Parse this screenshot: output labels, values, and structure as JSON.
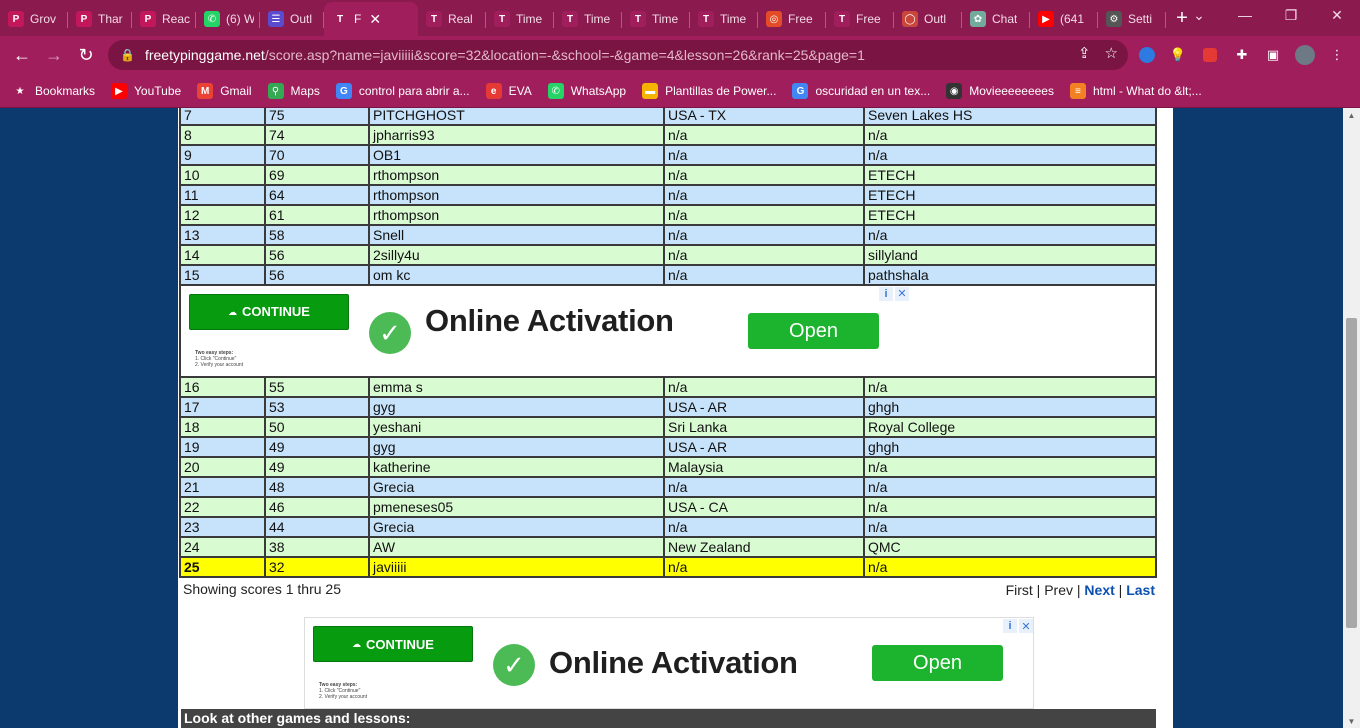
{
  "colors": {
    "tab_bg": "#8b1a4f",
    "toolbar_bg": "#a01e5c",
    "page_bg": "#0d3a6e",
    "row_blue": "#c7e3fb",
    "row_green": "#d9fbd2",
    "highlight": "#ffff00",
    "ad_green": "#079c10",
    "link": "#0b4fb0"
  },
  "tabs": [
    {
      "label": "Grov",
      "icon": "p-logo-icon",
      "color": "#c2185b"
    },
    {
      "label": "Thar",
      "icon": "p-logo-icon",
      "color": "#c2185b"
    },
    {
      "label": "Reac",
      "icon": "p-logo-icon",
      "color": "#c2185b"
    },
    {
      "label": "(6) W",
      "icon": "whatsapp-icon",
      "color": "#25d366"
    },
    {
      "label": "Outl",
      "icon": "list-icon",
      "color": "#5b4ccf"
    },
    {
      "label": "F",
      "icon": "t-logo-icon",
      "color": "#a01e5c",
      "active": true
    },
    {
      "label": "Real",
      "icon": "t-logo-icon",
      "color": "#a01e5c"
    },
    {
      "label": "Time",
      "icon": "t-logo-icon",
      "color": "#a01e5c"
    },
    {
      "label": "Time",
      "icon": "t-logo-icon",
      "color": "#a01e5c"
    },
    {
      "label": "Time",
      "icon": "t-logo-icon",
      "color": "#a01e5c"
    },
    {
      "label": "Time",
      "icon": "t-logo-icon",
      "color": "#a01e5c"
    },
    {
      "label": "Free",
      "icon": "circle-logo-icon",
      "color": "#e34c26"
    },
    {
      "label": "Free",
      "icon": "t-logo-icon",
      "color": "#a01e5c"
    },
    {
      "label": "Outl",
      "icon": "outlook-icon",
      "color": "#c9463d"
    },
    {
      "label": "Chat",
      "icon": "chatgpt-icon",
      "color": "#74aa9c"
    },
    {
      "label": "(641",
      "icon": "youtube-icon",
      "color": "#ff0000"
    },
    {
      "label": "Setti",
      "icon": "gear-icon",
      "color": "#555555"
    }
  ],
  "toolbar": {
    "url_host": "freetypinggame.net",
    "url_path": "/score.asp?name=javiiiii&score=32&location=-&school=-&game=4&lesson=26&rank=25&page=1"
  },
  "bookmarks": [
    {
      "label": "Bookmarks",
      "icon": "star-icon",
      "color": "transparent"
    },
    {
      "label": "YouTube",
      "icon": "youtube-icon",
      "color": "#ff0000"
    },
    {
      "label": "Gmail",
      "icon": "gmail-icon",
      "color": "#ea4335"
    },
    {
      "label": "Maps",
      "icon": "maps-icon",
      "color": "#34a853"
    },
    {
      "label": "control para abrir a...",
      "icon": "google-icon",
      "color": "#4285f4"
    },
    {
      "label": "EVA",
      "icon": "eva-icon",
      "color": "#e53935"
    },
    {
      "label": "WhatsApp",
      "icon": "whatsapp-icon",
      "color": "#25d366"
    },
    {
      "label": "Plantillas de Power...",
      "icon": "slides-icon",
      "color": "#f4b400"
    },
    {
      "label": "oscuridad en un tex...",
      "icon": "google-icon",
      "color": "#4285f4"
    },
    {
      "label": "Movieeeeeeees",
      "icon": "globe-icon",
      "color": "#333333"
    },
    {
      "label": "html - What do &lt;...",
      "icon": "stackoverflow-icon",
      "color": "#f48024"
    }
  ],
  "rows_top": [
    {
      "rank": "7",
      "score": "75",
      "name": "PITCHGHOST",
      "location": "USA - TX",
      "school": "Seven Lakes HS",
      "style": "blue"
    },
    {
      "rank": "8",
      "score": "74",
      "name": "jpharris93",
      "location": "n/a",
      "school": "n/a",
      "style": "green"
    },
    {
      "rank": "9",
      "score": "70",
      "name": "OB1",
      "location": "n/a",
      "school": "n/a",
      "style": "blue"
    },
    {
      "rank": "10",
      "score": "69",
      "name": "rthompson",
      "location": "n/a",
      "school": "ETECH",
      "style": "green"
    },
    {
      "rank": "11",
      "score": "64",
      "name": "rthompson",
      "location": "n/a",
      "school": "ETECH",
      "style": "blue"
    },
    {
      "rank": "12",
      "score": "61",
      "name": "rthompson",
      "location": "n/a",
      "school": "ETECH",
      "style": "green"
    },
    {
      "rank": "13",
      "score": "58",
      "name": "Snell",
      "location": "n/a",
      "school": "n/a",
      "style": "blue"
    },
    {
      "rank": "14",
      "score": "56",
      "name": "2silly4u",
      "location": "n/a",
      "school": "sillyland",
      "style": "green"
    },
    {
      "rank": "15",
      "score": "56",
      "name": "om kc",
      "location": "n/a",
      "school": "pathshala",
      "style": "blue"
    }
  ],
  "rows_bottom": [
    {
      "rank": "16",
      "score": "55",
      "name": "emma s",
      "location": "n/a",
      "school": "n/a",
      "style": "green"
    },
    {
      "rank": "17",
      "score": "53",
      "name": "gyg",
      "location": "USA - AR",
      "school": "ghgh",
      "style": "blue"
    },
    {
      "rank": "18",
      "score": "50",
      "name": "yeshani",
      "location": "Sri Lanka",
      "school": "Royal College",
      "style": "green"
    },
    {
      "rank": "19",
      "score": "49",
      "name": "gyg",
      "location": "USA - AR",
      "school": "ghgh",
      "style": "blue"
    },
    {
      "rank": "20",
      "score": "49",
      "name": "katherine",
      "location": "Malaysia",
      "school": "n/a",
      "style": "green"
    },
    {
      "rank": "21",
      "score": "48",
      "name": "Grecia",
      "location": "n/a",
      "school": "n/a",
      "style": "blue"
    },
    {
      "rank": "22",
      "score": "46",
      "name": "pmeneses05",
      "location": "USA - CA",
      "school": "n/a",
      "style": "green"
    },
    {
      "rank": "23",
      "score": "44",
      "name": "Grecia",
      "location": "n/a",
      "school": "n/a",
      "style": "blue"
    },
    {
      "rank": "24",
      "score": "38",
      "name": "AW",
      "location": "New Zealand",
      "school": "QMC",
      "style": "green"
    },
    {
      "rank": "25",
      "score": "32",
      "name": "javiiiii",
      "location": "n/a",
      "school": "n/a",
      "style": "me"
    }
  ],
  "ad": {
    "continue_label": "CONTINUE",
    "steps_title": "Two easy steps:",
    "step1": "1. Click \"Continue\"",
    "step2": "2. Verify your account",
    "headline": "Online Activation",
    "open_label": "Open",
    "info_glyph": "i",
    "close_glyph": "✕"
  },
  "showing": "Showing scores 1 thru 25",
  "pager": {
    "first": "First",
    "sep1": " | ",
    "prev": "Prev",
    "sep2": " | ",
    "next": "Next",
    "sep3": " | ",
    "last": "Last"
  },
  "look_bar": "Look at other games and lessons:"
}
